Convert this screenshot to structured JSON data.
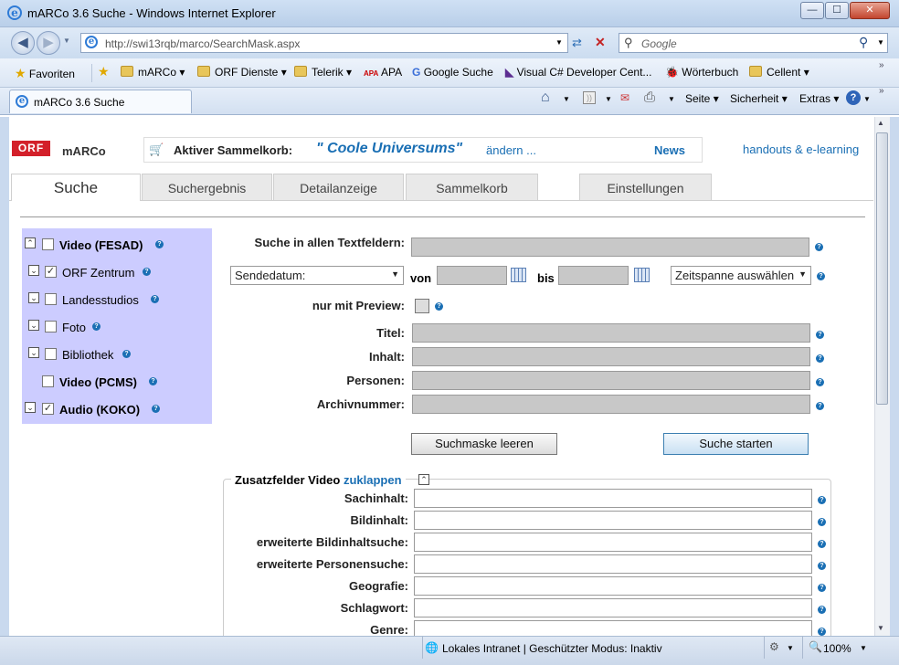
{
  "window": {
    "title": "mARCo 3.6 Suche - Windows Internet Explorer",
    "min": "—",
    "max": "☐",
    "close": "✕"
  },
  "address": {
    "url": "http://swi13rqb/marco/SearchMask.aspx",
    "search_placeholder": "Google"
  },
  "favorites": {
    "favoriten": "Favoriten",
    "items": [
      "mARCo",
      "ORF Dienste",
      "Telerik",
      "APA",
      "Google Suche",
      "Visual C# Developer Cent...",
      "Wörterbuch",
      "Cellent"
    ]
  },
  "tab": {
    "label": "mARCo 3.6 Suche"
  },
  "commands": {
    "seite": "Seite",
    "sicherheit": "Sicherheit",
    "extras": "Extras"
  },
  "app": {
    "logo": "ORF",
    "name": "mARCo",
    "cart_label": "Aktiver Sammelkorb:",
    "cart_name": "\" Coole Universums\"",
    "cart_change": "ändern ...",
    "news": "News",
    "handouts": "handouts & e-learning"
  },
  "tabs": [
    "Suche",
    "Suchergebnis",
    "Detailanzeige",
    "Sammelkorb",
    "Einstellungen"
  ],
  "sources": [
    {
      "label": "Video (FESAD)",
      "checked": false,
      "bold": true
    },
    {
      "label": "ORF Zentrum",
      "checked": true,
      "bold": false
    },
    {
      "label": "Landesstudios",
      "checked": false,
      "bold": false
    },
    {
      "label": "Foto",
      "checked": false,
      "bold": false
    },
    {
      "label": "Bibliothek",
      "checked": false,
      "bold": false
    },
    {
      "label": "Video (PCMS)",
      "checked": false,
      "bold": true
    },
    {
      "label": "Audio (KOKO)",
      "checked": true,
      "bold": true
    }
  ],
  "form": {
    "all_fields": "Suche in allen Textfeldern:",
    "date_select": "Sendedatum:",
    "von": "von",
    "bis": "bis",
    "range_select": "Zeitspanne auswählen",
    "preview": "nur mit Preview:",
    "titel": "Titel:",
    "inhalt": "Inhalt:",
    "personen": "Personen:",
    "archiv": "Archivnummer:",
    "clear": "Suchmaske leeren",
    "start": "Suche starten"
  },
  "extra": {
    "legend": "Zusatzfelder Video",
    "collapse": "zuklappen",
    "fields": [
      "Sachinhalt:",
      "Bildinhalt:",
      "erweiterte Bildinhaltsuche:",
      "erweiterte Personensuche:",
      "Geografie:",
      "Schlagwort:",
      "Genre:"
    ]
  },
  "status": {
    "zone": "Lokales Intranet | Geschützter Modus: Inaktiv",
    "zoom": "100%"
  }
}
